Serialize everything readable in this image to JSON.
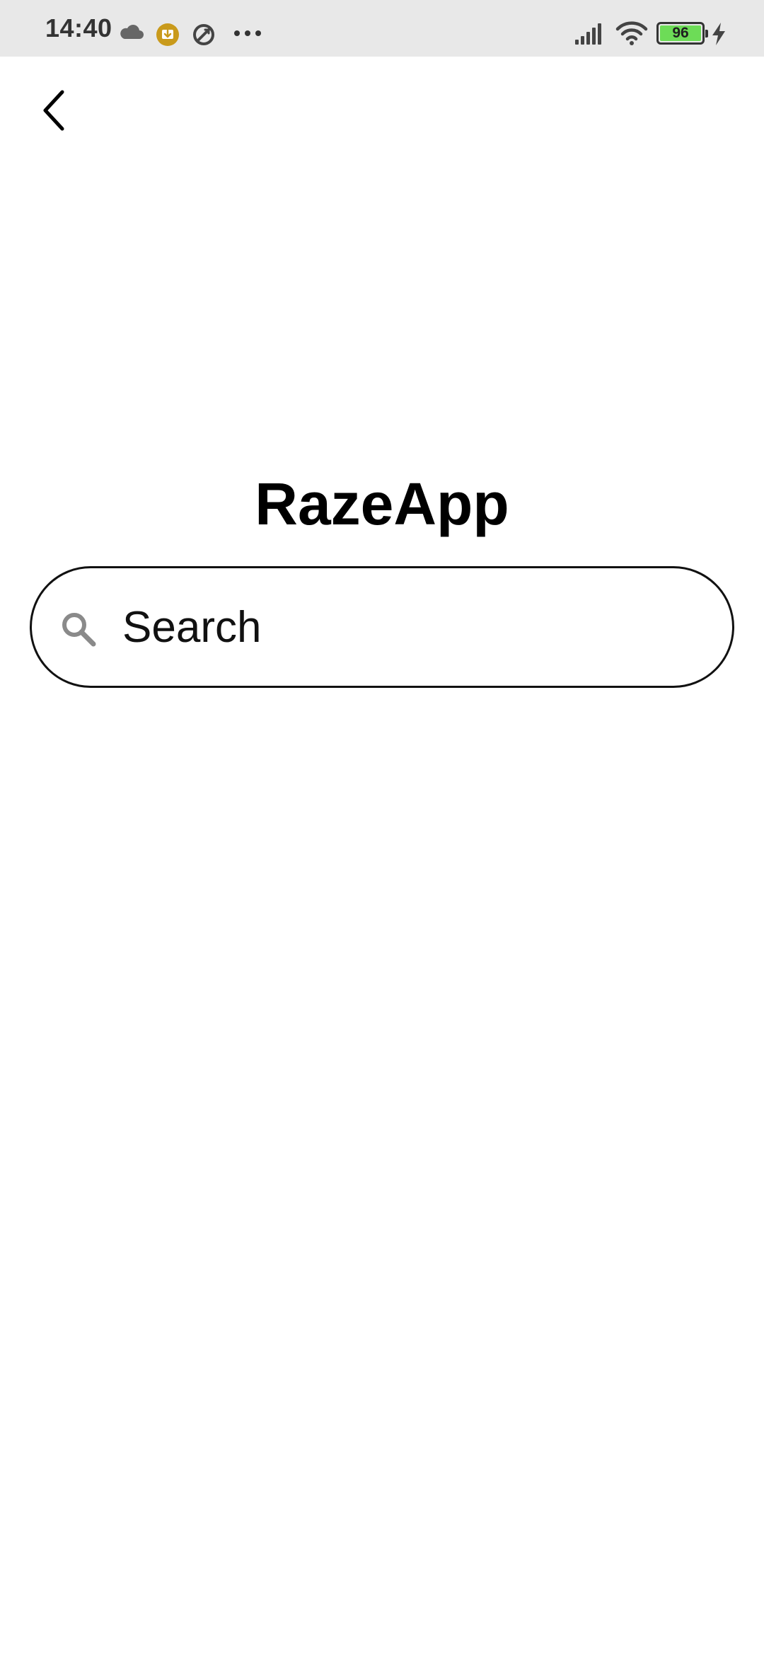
{
  "status_bar": {
    "time": "14:40",
    "battery_level": "96",
    "battery_color": "#6ddc57",
    "left_icons": [
      "cloud-icon",
      "download-badge-icon",
      "sync-icon",
      "more-icon"
    ],
    "right_icons": [
      "signal-icon",
      "wifi-icon",
      "battery-icon",
      "charging-icon"
    ]
  },
  "header": {
    "back_icon": "chevron-left-icon"
  },
  "main": {
    "title": "RazeApp",
    "search": {
      "placeholder": "Search",
      "value": "",
      "icon": "search-icon"
    }
  }
}
